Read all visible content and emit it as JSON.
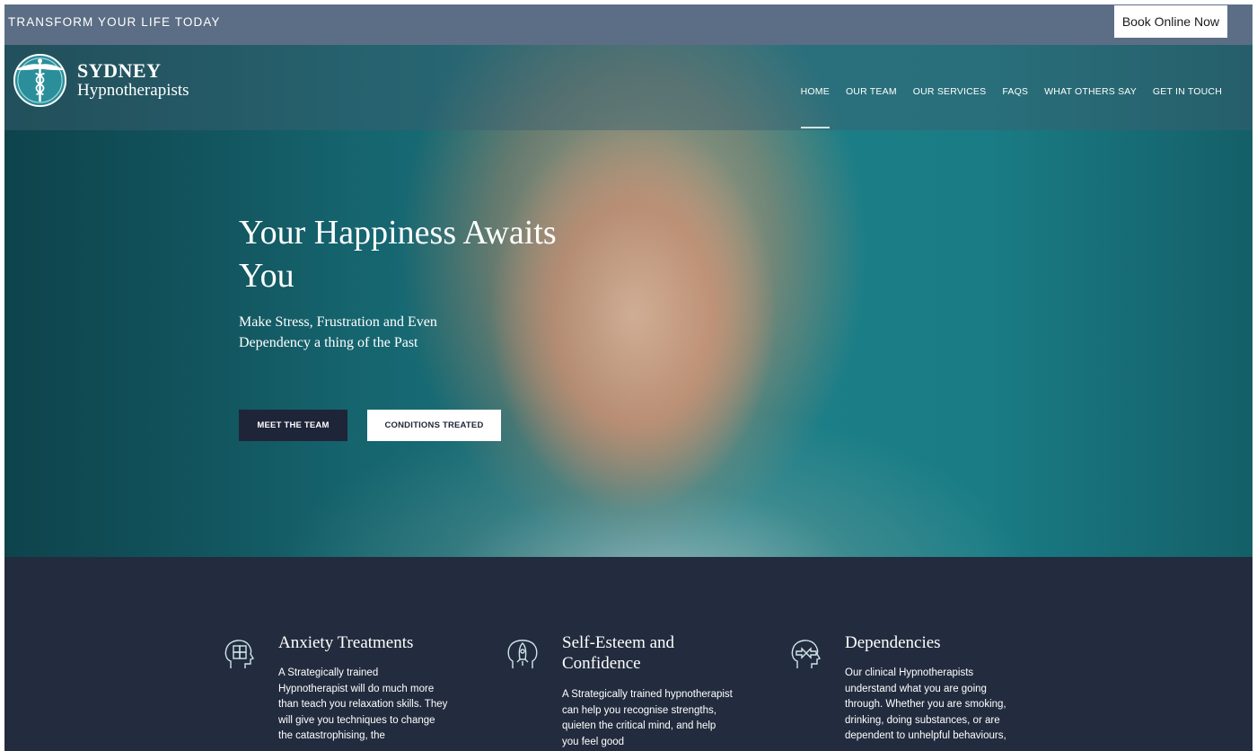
{
  "topbar": {
    "tagline": "TRANSFORM YOUR LIFE TODAY",
    "book_button": "Book Online Now"
  },
  "logo": {
    "line1": "SYDNEY",
    "line2": "Hypnotherapists"
  },
  "nav": {
    "items": [
      "HOME",
      "OUR TEAM",
      "OUR SERVICES",
      "FAQS",
      "WHAT OTHERS SAY",
      "GET IN TOUCH"
    ],
    "active": "HOME"
  },
  "hero": {
    "title": "Your Happiness Awaits You",
    "subtitle": "Make Stress, Frustration and Even Dependency a thing of the Past",
    "primary_button": "MEET THE TEAM",
    "secondary_button": "CONDITIONS TREATED"
  },
  "services": [
    {
      "icon": "puzzle-head-icon",
      "title": "Anxiety Treatments",
      "body": "A Strategically trained Hypnotherapist will do much more than teach you relaxation skills. They will give you techniques to change the catastrophising, the"
    },
    {
      "icon": "rocket-head-icon",
      "title": "Self-Esteem and Confidence",
      "body": "A Strategically trained hypnotherapist can help you recognise strengths, quieten the critical mind, and help you feel good"
    },
    {
      "icon": "arrows-head-icon",
      "title": "Dependencies",
      "body": "Our clinical Hypnotherapists understand what you are going through. Whether you are smoking, drinking, doing substances, or are dependent to unhelpful behaviours,"
    }
  ],
  "colors": {
    "topbar": "#5c6e85",
    "dark_navy": "#232c3e",
    "button_dark": "#1f2538",
    "teal": "#1d7f88"
  }
}
